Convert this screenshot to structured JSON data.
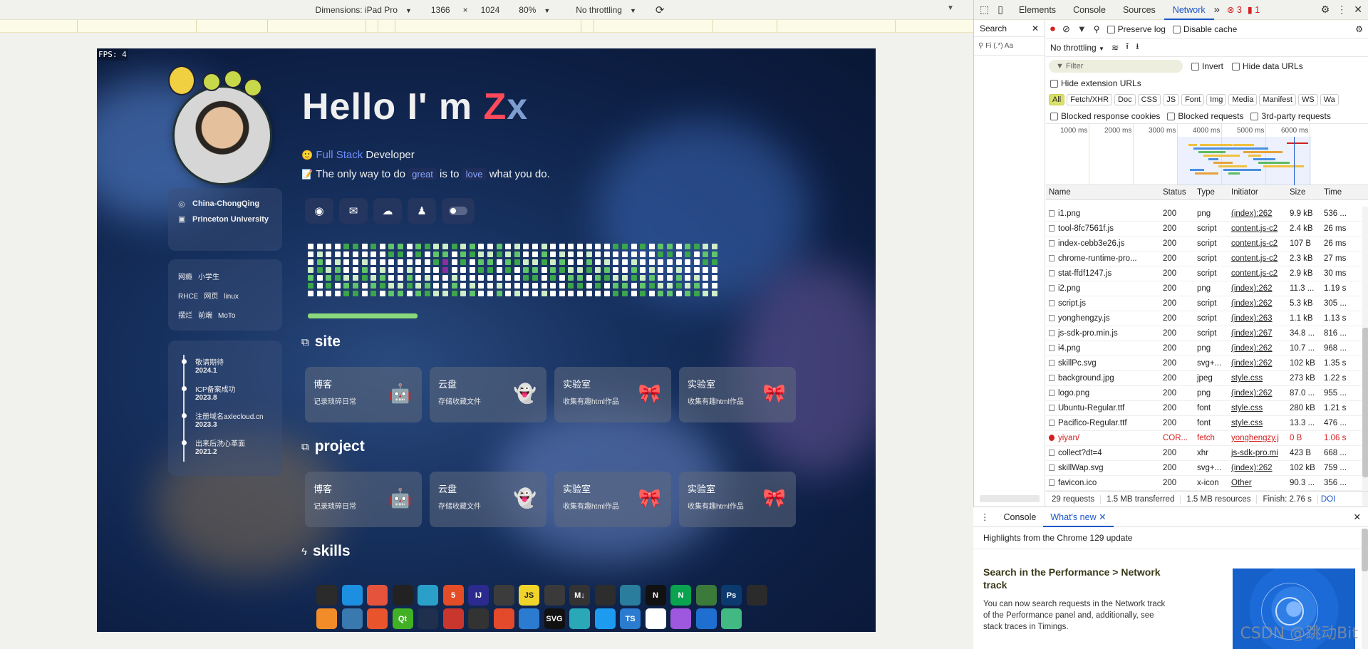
{
  "device_toolbar": {
    "dimensions": "Dimensions: iPad Pro",
    "width": "1366",
    "times": "×",
    "height": "1024",
    "zoom": "80%",
    "throttling": "No throttling"
  },
  "page": {
    "fps": "FPS: 4",
    "hello_prefix": "Hello I' m ",
    "hello_z": "Z",
    "hello_x": "x",
    "line1": {
      "emoji": "🙂",
      "blue": "Full Stack",
      "rest": " Developer"
    },
    "line2": {
      "emoji": "📝",
      "a": "The only way to do ",
      "tag1": "great",
      "b": " is to ",
      "tag2": "love",
      "c": " what you do."
    },
    "social_icons": [
      "github-icon",
      "mail-icon",
      "cloud-icon",
      "qq-icon",
      "toggle-icon"
    ],
    "info": {
      "location": "China-ChongQing",
      "school": "Princeton University"
    },
    "tags": [
      "网瘾",
      "小学生",
      "RHCE",
      "网页",
      "linux",
      "摆烂",
      "前端",
      "MoTo"
    ],
    "timeline": [
      {
        "title": "敬请期待",
        "date": "2024.1"
      },
      {
        "title": "ICP备案成功",
        "date": "2023.8"
      },
      {
        "title": "注册域名axlecloud.cn",
        "date": "2023.3"
      },
      {
        "title": "出来后洗心革面",
        "date": "2021.2"
      }
    ],
    "sections": {
      "site": "site",
      "project": "project",
      "skills": "skills"
    },
    "site_tiles": [
      {
        "t1": "博客",
        "t2": "记录琐碎日常",
        "emo": "🤖"
      },
      {
        "t1": "云盘",
        "t2": "存储收藏文件",
        "emo": "👻"
      },
      {
        "t1": "实验室",
        "t2": "收集有趣html作品",
        "emo": "🎀"
      },
      {
        "t1": "实验室",
        "t2": "收集有趣html作品",
        "emo": "🎀"
      }
    ],
    "project_tiles": [
      {
        "t1": "博客",
        "t2": "记录琐碎日常",
        "emo": "🤖"
      },
      {
        "t1": "云盘",
        "t2": "存储收藏文件",
        "emo": "👻"
      },
      {
        "t1": "实验室",
        "t2": "收集有趣html作品",
        "emo": "🎀"
      },
      {
        "t1": "实验室",
        "t2": "收集有趣html作品",
        "emo": "🎀"
      }
    ],
    "skills_row1": [
      "",
      "",
      "",
      "",
      "",
      "5",
      "IJ",
      "",
      "JS",
      "",
      "M↓",
      "",
      "",
      "N",
      "N",
      "",
      "Ps",
      ""
    ],
    "skills_row2": [
      "",
      "",
      "",
      "Qt",
      "",
      "",
      "",
      "",
      "",
      "SVG",
      "",
      "",
      "TS",
      "",
      "",
      "",
      ""
    ]
  },
  "devtools": {
    "tabs": [
      "Elements",
      "Console",
      "Sources",
      "Network"
    ],
    "active_tab": "Network",
    "more": "»",
    "errors": "3",
    "warnings": "1",
    "search_label": "Search",
    "search_opts": "Fi  (.*)  Aa",
    "preserve_log": "Preserve log",
    "disable_cache": "Disable cache",
    "no_throttling": "No throttling",
    "filter_placeholder": "Filter",
    "invert": "Invert",
    "hide_data_urls": "Hide data URLs",
    "hide_extension_urls": "Hide extension URLs",
    "type_filters": [
      "All",
      "Fetch/XHR",
      "Doc",
      "CSS",
      "JS",
      "Font",
      "Img",
      "Media",
      "Manifest",
      "WS",
      "Wa"
    ],
    "blocked_cookies": "Blocked response cookies",
    "blocked_requests": "Blocked requests",
    "third_party": "3rd-party requests",
    "timeline_ticks": [
      "1000 ms",
      "2000 ms",
      "3000 ms",
      "4000 ms",
      "5000 ms",
      "6000 ms"
    ],
    "columns": [
      "Name",
      "Status",
      "Type",
      "Initiator",
      "Size",
      "Time"
    ],
    "requests": [
      {
        "name": "i1.png",
        "status": "200",
        "type": "png",
        "initiator": "(index):262",
        "size": "9.9 kB",
        "time": "536 ..."
      },
      {
        "name": "tool-8fc7561f.js",
        "status": "200",
        "type": "script",
        "initiator": "content.js-c2",
        "size": "2.4 kB",
        "time": "26 ms"
      },
      {
        "name": "index-cebb3e26.js",
        "status": "200",
        "type": "script",
        "initiator": "content.js-c2",
        "size": "107 B",
        "time": "26 ms"
      },
      {
        "name": "chrome-runtime-pro...",
        "status": "200",
        "type": "script",
        "initiator": "content.js-c2",
        "size": "2.3 kB",
        "time": "27 ms"
      },
      {
        "name": "stat-ffdf1247.js",
        "status": "200",
        "type": "script",
        "initiator": "content.js-c2",
        "size": "2.9 kB",
        "time": "30 ms"
      },
      {
        "name": "i2.png",
        "status": "200",
        "type": "png",
        "initiator": "(index):262",
        "size": "11.3 ...",
        "time": "1.19 s"
      },
      {
        "name": "script.js",
        "status": "200",
        "type": "script",
        "initiator": "(index):262",
        "size": "5.3 kB",
        "time": "305 ..."
      },
      {
        "name": "yonghengzy.js",
        "status": "200",
        "type": "script",
        "initiator": "(index):263",
        "size": "1.1 kB",
        "time": "1.13 s"
      },
      {
        "name": "js-sdk-pro.min.js",
        "status": "200",
        "type": "script",
        "initiator": "(index):267",
        "size": "34.8 ...",
        "time": "816 ..."
      },
      {
        "name": "i4.png",
        "status": "200",
        "type": "png",
        "initiator": "(index):262",
        "size": "10.7 ...",
        "time": "968 ..."
      },
      {
        "name": "skillPc.svg",
        "status": "200",
        "type": "svg+...",
        "initiator": "(index):262",
        "size": "102 kB",
        "time": "1.35 s"
      },
      {
        "name": "background.jpg",
        "status": "200",
        "type": "jpeg",
        "initiator": "style.css",
        "size": "273 kB",
        "time": "1.22 s"
      },
      {
        "name": "logo.png",
        "status": "200",
        "type": "png",
        "initiator": "(index):262",
        "size": "87.0 ...",
        "time": "955 ..."
      },
      {
        "name": "Ubuntu-Regular.ttf",
        "status": "200",
        "type": "font",
        "initiator": "style.css",
        "size": "280 kB",
        "time": "1.21 s"
      },
      {
        "name": "Pacifico-Regular.ttf",
        "status": "200",
        "type": "font",
        "initiator": "style.css",
        "size": "13.3 ...",
        "time": "476 ..."
      },
      {
        "name": "yiyan/",
        "status": "COR...",
        "type": "fetch",
        "initiator": "yonghengzy.j",
        "size": "0 B",
        "time": "1.06 s",
        "error": true
      },
      {
        "name": "collect?dt=4",
        "status": "200",
        "type": "xhr",
        "initiator": "js-sdk-pro.mi",
        "size": "423 B",
        "time": "668 ..."
      },
      {
        "name": "skillWap.svg",
        "status": "200",
        "type": "svg+...",
        "initiator": "(index):262",
        "size": "102 kB",
        "time": "759 ..."
      },
      {
        "name": "favicon.ico",
        "status": "200",
        "type": "x-icon",
        "initiator": "Other",
        "size": "90.3 ...",
        "time": "356 ..."
      }
    ],
    "summary": [
      "29 requests",
      "1.5 MB transferred",
      "1.5 MB resources",
      "Finish: 2.76 s",
      "DOI"
    ],
    "drawer_tabs": [
      "Console",
      "What's new"
    ],
    "whats_new_header": "Highlights from the Chrome 129 update",
    "article_title": "Search in the Performance > Network track",
    "article_body": "You can now search requests in the Network track of the Performance panel and, additionally, see stack traces in Timings.",
    "watermark": "CSDN @跳动Bit"
  }
}
